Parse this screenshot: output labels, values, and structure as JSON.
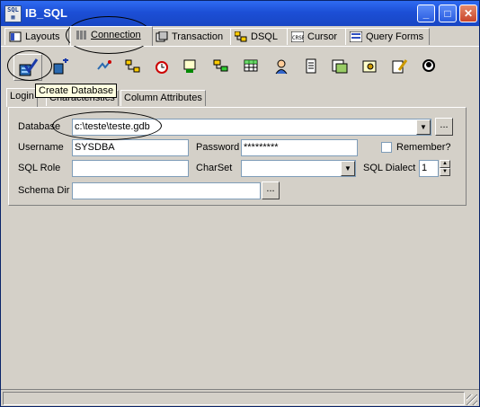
{
  "window": {
    "title": "IB_SQL"
  },
  "tabs": [
    {
      "label": "Layouts",
      "icon": "layouts-icon"
    },
    {
      "label": "Connection",
      "icon": "connection-icon",
      "active": true
    },
    {
      "label": "Transaction",
      "icon": "transaction-icon"
    },
    {
      "label": "DSQL",
      "icon": "dsql-icon"
    },
    {
      "label": "Cursor",
      "icon": "cursor-icon"
    },
    {
      "label": "Query Forms",
      "icon": "query-forms-icon"
    }
  ],
  "toolbar": {
    "tooltip": "Create Database",
    "buttons": [
      "create-database-icon",
      "add-database-icon",
      "connect-icon",
      "network-icon",
      "alarm-clock-icon",
      "form-icon",
      "tree-icon",
      "grid-icon",
      "user-icon",
      "document-icon",
      "table-icon",
      "settings-icon",
      "edit-icon",
      "person-icon"
    ]
  },
  "subtabs": [
    {
      "label": "Login",
      "active": true
    },
    {
      "label": "Characteristics"
    },
    {
      "label": "Column Attributes"
    }
  ],
  "login": {
    "database_label": "Database",
    "database_value": "c:\\teste\\teste.gdb",
    "username_label": "Username",
    "username_value": "SYSDBA",
    "password_label": "Password",
    "password_value": "*********",
    "remember_label": "Remember?",
    "sqlrole_label": "SQL Role",
    "sqlrole_value": "",
    "charset_label": "CharSet",
    "charset_value": "",
    "dialect_label": "SQL Dialect",
    "dialect_value": "1",
    "schema_label": "Schema Dir",
    "schema_value": "",
    "browse_label": "..."
  },
  "colors": {
    "titlebar": "#1c4fd6",
    "face": "#d4d0c8",
    "tooltip": "#ffffe1"
  }
}
